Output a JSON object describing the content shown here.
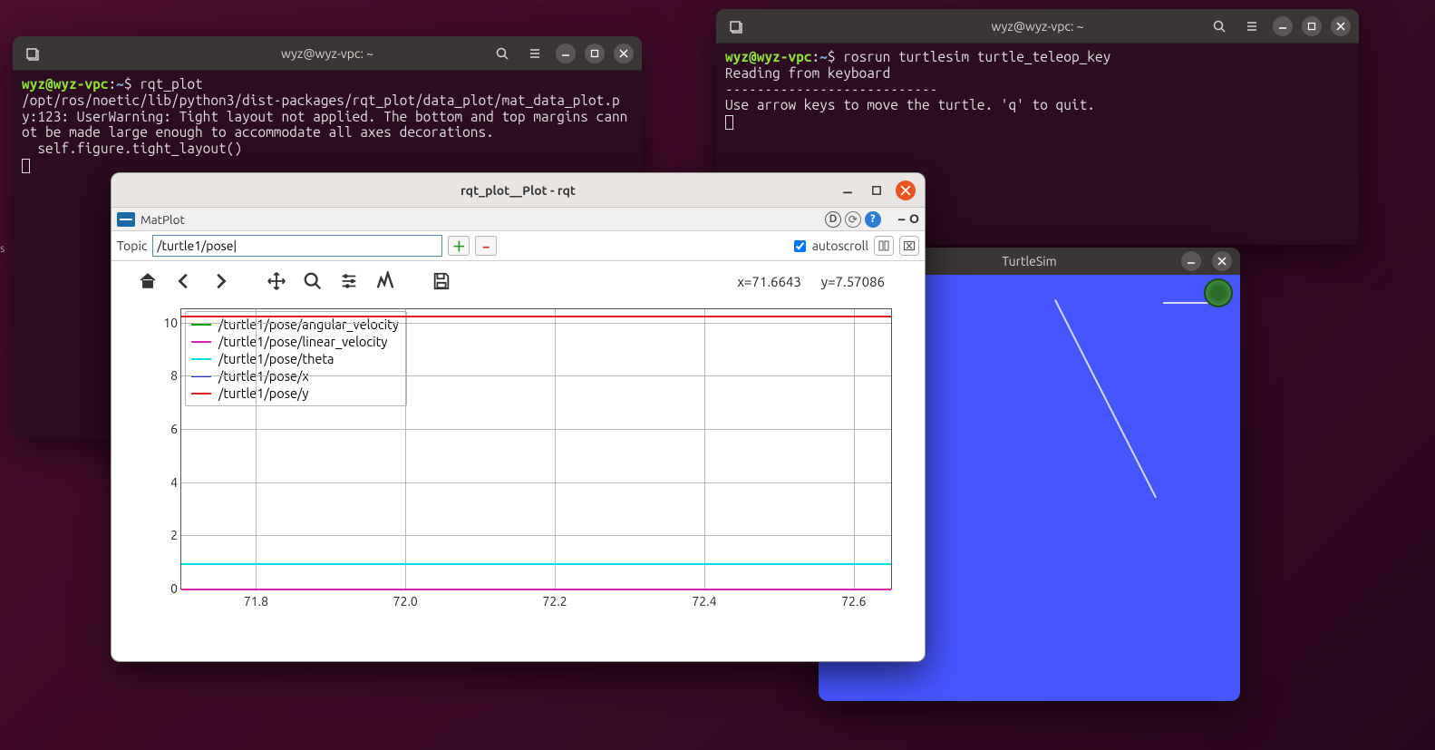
{
  "desktop_stub": "s",
  "terminal1": {
    "title": "wyz@wyz-vpc: ~",
    "prompt_user": "wyz@wyz-vpc",
    "prompt_path": "~",
    "command": "rqt_plot",
    "output": "/opt/ros/noetic/lib/python3/dist-packages/rqt_plot/data_plot/mat_data_plot.py:123: UserWarning: Tight layout not applied. The bottom and top margins cannot be made large enough to accommodate all axes decorations.\n  self.figure.tight_layout()"
  },
  "terminal2": {
    "title": "wyz@wyz-vpc: ~",
    "prompt_user": "wyz@wyz-vpc",
    "prompt_path": "~",
    "command": "rosrun turtlesim turtle_teleop_key",
    "output": "Reading from keyboard\n---------------------------\nUse arrow keys to move the turtle. 'q' to quit."
  },
  "rqt": {
    "title": "rqt_plot__Plot - rqt",
    "matplot_label": "MatPlot",
    "toolbar_icons": {
      "d": "D",
      "reload": "⟳",
      "help": "?",
      "minus": "−",
      "o": "O"
    },
    "topic_label": "Topic",
    "topic_value": "/turtle1/pose|",
    "autoscroll_label": "autoscroll",
    "autoscroll_checked": true,
    "coord_x": "x=71.6643",
    "coord_y": "y=7.57086"
  },
  "chart_data": {
    "type": "line",
    "xlim": [
      71.7,
      72.65
    ],
    "ylim": [
      0,
      10.5
    ],
    "xticks": [
      71.8,
      72.0,
      72.2,
      72.4,
      72.6
    ],
    "yticks": [
      0,
      2,
      4,
      6,
      8,
      10
    ],
    "series": [
      {
        "name": "/turtle1/pose/angular_velocity",
        "color": "#00a000",
        "const_y": 0
      },
      {
        "name": "/turtle1/pose/linear_velocity",
        "color": "#e020b0",
        "const_y": 0
      },
      {
        "name": "/turtle1/pose/theta",
        "color": "#00e0e0",
        "const_y": 0.95
      },
      {
        "name": "/turtle1/pose/x",
        "color": "#2030c0",
        "const_y": 10.25
      },
      {
        "name": "/turtle1/pose/y",
        "color": "#e02020",
        "const_y": 10.25
      }
    ]
  },
  "turtlesim": {
    "title": "TurtleSim"
  }
}
